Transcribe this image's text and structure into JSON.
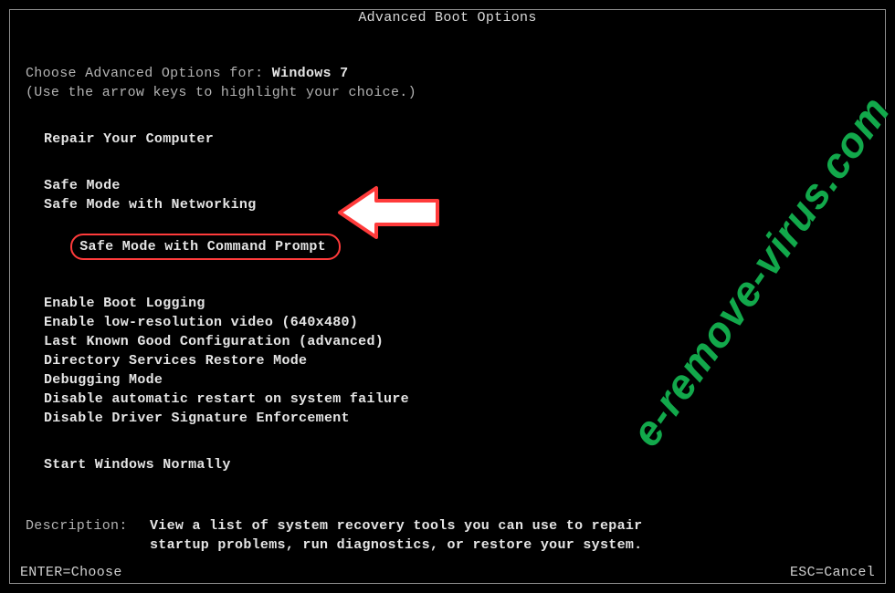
{
  "title": "Advanced Boot Options",
  "intro_prefix": "Choose Advanced Options for: ",
  "os_name": "Windows 7",
  "hint": "(Use the arrow keys to highlight your choice.)",
  "repair": "Repair Your Computer",
  "options_a": [
    "Safe Mode",
    "Safe Mode with Networking"
  ],
  "highlighted": "Safe Mode with Command Prompt",
  "options_b": [
    "Enable Boot Logging",
    "Enable low-resolution video (640x480)",
    "Last Known Good Configuration (advanced)",
    "Directory Services Restore Mode",
    "Debugging Mode",
    "Disable automatic restart on system failure",
    "Disable Driver Signature Enforcement"
  ],
  "start_normal": "Start Windows Normally",
  "desc_label": "Description:",
  "desc_line1": "View a list of system recovery tools you can use to repair",
  "desc_line2": "startup problems, run diagnostics, or restore your system.",
  "footer_left": "ENTER=Choose",
  "footer_right": "ESC=Cancel",
  "watermark": "e-remove-virus.com"
}
